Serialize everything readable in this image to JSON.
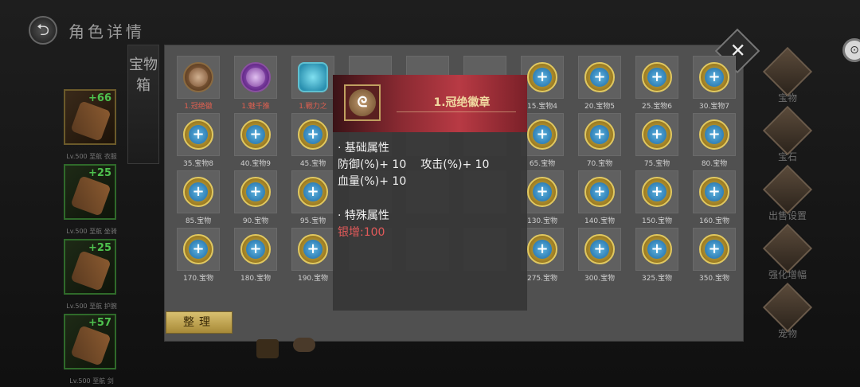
{
  "header": {
    "title": "角色详情"
  },
  "panel": {
    "tab_label": "宝物箱",
    "sort_label": "整理",
    "close_glyph": "✕"
  },
  "equipment": [
    {
      "plus": "+66",
      "sub": "Lv.500 至航 衣服",
      "style": "gold"
    },
    {
      "plus": "+25",
      "sub": "Lv.500 至航 坐骑",
      "style": "green"
    },
    {
      "plus": "+25",
      "sub": "Lv.500 至航 护腕",
      "style": "green"
    },
    {
      "plus": "+57",
      "sub": "Lv.500 至航 剑",
      "style": "green"
    }
  ],
  "side_menu": [
    {
      "label": "宝物",
      "icon": "treasure-icon"
    },
    {
      "label": "宝石",
      "icon": "gem-icon"
    },
    {
      "label": "出售设置",
      "icon": "gear-icon"
    },
    {
      "label": "强化增幅",
      "icon": "upgrade-icon"
    },
    {
      "label": "宠物",
      "icon": "pet-icon"
    }
  ],
  "grid": {
    "rows": [
      [
        {
          "label": "1.冠绝徽",
          "coin": "brown",
          "red": true
        },
        {
          "label": "1.魅千推",
          "coin": "purple",
          "red": true
        },
        {
          "label": "1.戰力之",
          "coin": "cyan",
          "red": true
        },
        {
          "label": "",
          "coin": "hidden"
        },
        {
          "label": "",
          "coin": "hidden"
        },
        {
          "label": "",
          "coin": "hidden"
        },
        {
          "label": "15.宝物4",
          "coin": "gold"
        },
        {
          "label": "20.宝物5",
          "coin": "blue"
        },
        {
          "label": "25.宝物6",
          "coin": "blue"
        },
        {
          "label": "30.宝物7",
          "coin": "blue"
        }
      ],
      [
        {
          "label": "35.宝物8",
          "coin": "blue"
        },
        {
          "label": "40.宝物9",
          "coin": "blue"
        },
        {
          "label": "45.宝物",
          "coin": "blue"
        },
        {
          "label": "",
          "coin": "hidden"
        },
        {
          "label": "",
          "coin": "hidden"
        },
        {
          "label": "",
          "coin": "hidden"
        },
        {
          "label": "65.宝物",
          "coin": "blue"
        },
        {
          "label": "70.宝物",
          "coin": "blue"
        },
        {
          "label": "75.宝物",
          "coin": "blue"
        },
        {
          "label": "80.宝物",
          "coin": "blue"
        }
      ],
      [
        {
          "label": "85.宝物",
          "coin": "blue"
        },
        {
          "label": "90.宝物",
          "coin": "blue"
        },
        {
          "label": "95.宝物",
          "coin": "blue"
        },
        {
          "label": "",
          "coin": "hidden"
        },
        {
          "label": "",
          "coin": "hidden"
        },
        {
          "label": "",
          "coin": "hidden"
        },
        {
          "label": "130.宝物",
          "coin": "blue"
        },
        {
          "label": "140.宝物",
          "coin": "blue"
        },
        {
          "label": "150.宝物",
          "coin": "blue"
        },
        {
          "label": "160.宝物",
          "coin": "blue"
        }
      ],
      [
        {
          "label": "170.宝物",
          "coin": "blue"
        },
        {
          "label": "180.宝物",
          "coin": "blue"
        },
        {
          "label": "190.宝物",
          "coin": "blue"
        },
        {
          "label": "",
          "coin": "hidden"
        },
        {
          "label": "",
          "coin": "hidden"
        },
        {
          "label": "",
          "coin": "hidden"
        },
        {
          "label": "275.宝物",
          "coin": "blue"
        },
        {
          "label": "300.宝物",
          "coin": "blue"
        },
        {
          "label": "325.宝物",
          "coin": "blue"
        },
        {
          "label": "350.宝物",
          "coin": "blue"
        }
      ]
    ]
  },
  "tooltip": {
    "name": "1.冠绝徽章",
    "icon_glyph": "ᘓ",
    "base_title": "· 基础属性",
    "base_stats": [
      [
        "防御(%)+ 10",
        "攻击(%)+ 10"
      ],
      [
        "血量(%)+ 10",
        ""
      ]
    ],
    "special_title": "· 特殊属性",
    "special_text": "银增:100"
  },
  "icons": {
    "back": "⮌",
    "edge": "⊙"
  }
}
